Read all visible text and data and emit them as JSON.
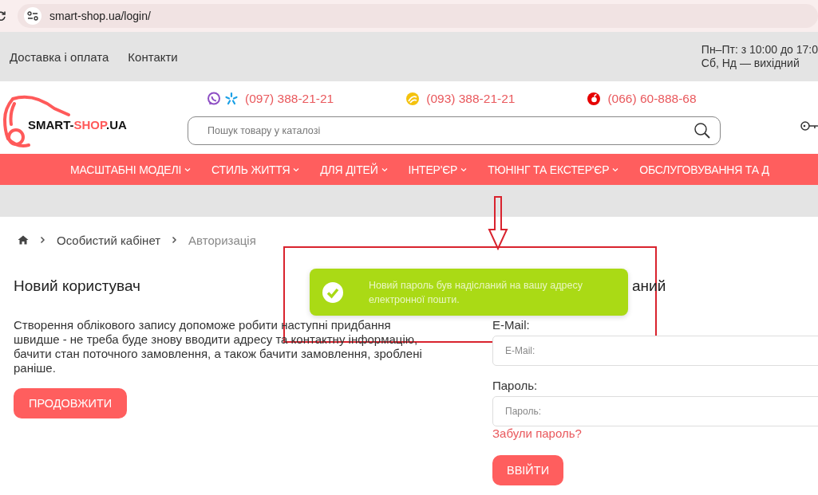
{
  "browser": {
    "url": "smart-shop.ua/login/"
  },
  "top_bar": {
    "links": [
      "Доставка і оплата",
      "Контакти"
    ],
    "hours": [
      "Пн–Пт: з 10:00 до 17:0",
      "Сб, Нд — вихідний"
    ]
  },
  "header": {
    "logo": {
      "part_1": "SMART-",
      "part_2": "SHOP",
      "part_3": ".UA"
    },
    "phones": [
      {
        "kind": "viber-kyivstar",
        "number": "(097) 388-21-21"
      },
      {
        "kind": "lifecell",
        "number": "(093) 388-21-21"
      },
      {
        "kind": "vodafone",
        "number": "(066) 60-888-68"
      }
    ],
    "search": {
      "placeholder": "Пошук товару у каталозі"
    }
  },
  "nav": [
    {
      "label": "МАСШТАБНІ МОДЕЛІ",
      "has_menu": true
    },
    {
      "label": "СТИЛЬ ЖИТТЯ",
      "has_menu": true
    },
    {
      "label": "ДЛЯ ДІТЕЙ",
      "has_menu": true
    },
    {
      "label": "ІНТЕР'ЄР",
      "has_menu": true
    },
    {
      "label": "ТЮНІНГ ТА ЕКСТЕР'ЄР",
      "has_menu": true
    },
    {
      "label": "ОБСЛУГОВУВАННЯ ТА Д",
      "has_menu": false
    }
  ],
  "breadcrumb": [
    {
      "label": "Особистий кабінет",
      "current": false
    },
    {
      "label": "Авторизація",
      "current": true
    }
  ],
  "new_customer": {
    "title": "Новий користувач",
    "text": "Створення облікового запису допоможе робити наступні придбання швидше - не треба буде знову вводити адресу та контактну інформацію, бачити стан поточного замовлення, а також бачити замовлення, зроблені раніше.",
    "button": "ПРОДОВЖИТИ"
  },
  "login": {
    "title": "аний",
    "email_label": "E-Mail:",
    "email_placeholder": "E-Mail:",
    "password_label": "Пароль:",
    "password_placeholder": "Пароль:",
    "forgot_link": "Забули пароль?",
    "button": "ВВІЙТИ"
  },
  "toast": {
    "message": "Новий пароль був надісланий на вашу адресу електронної пошти."
  }
}
